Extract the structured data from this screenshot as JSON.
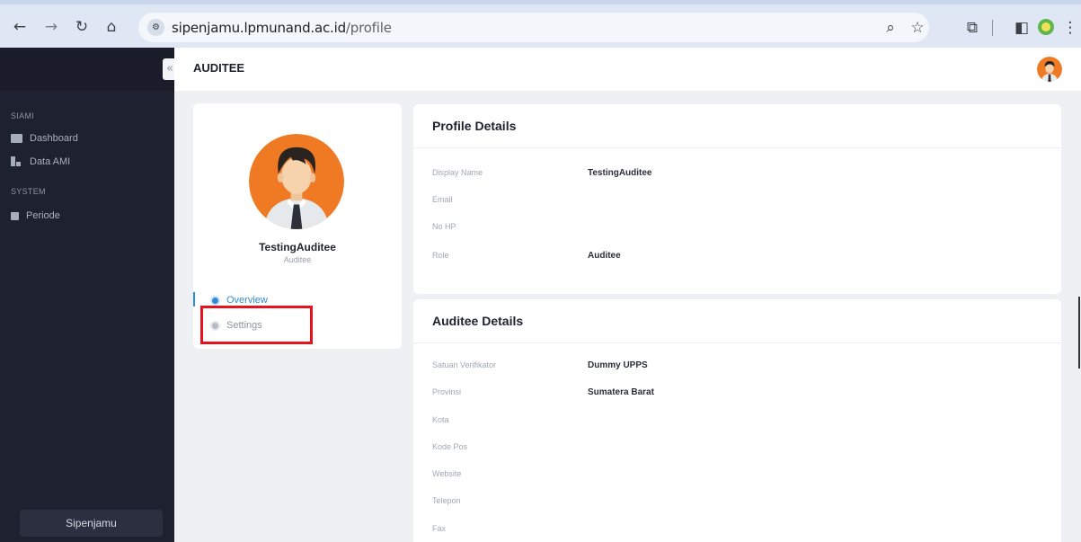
{
  "browser": {
    "url_host": "sipenjamu.lpmunand.ac.id",
    "url_path": "/profile",
    "icons": [
      "back-icon",
      "forward-icon",
      "reload-icon",
      "home-icon",
      "site-settings-icon",
      "zoom-icon",
      "bookmark-star-icon",
      "extensions-icon",
      "sidepanel-icon",
      "profile-icon",
      "menu-icon"
    ]
  },
  "sidebar": {
    "sections": [
      {
        "heading": "SIAMI",
        "items": [
          {
            "label": "Dashboard",
            "icon": "monitor-icon"
          },
          {
            "label": "Data AMI",
            "icon": "chart-icon"
          }
        ]
      },
      {
        "heading": "SYSTEM",
        "items": [
          {
            "label": "Periode",
            "icon": "calendar-icon"
          }
        ]
      }
    ],
    "footer": "Sipenjamu",
    "collapse_glyph": "«"
  },
  "appbar": {
    "title": "AUDITEE"
  },
  "profile": {
    "name": "TestingAuditee",
    "role": "Auditee",
    "menu": [
      {
        "label": "Overview",
        "active": true
      },
      {
        "label": "Settings",
        "active": false
      }
    ]
  },
  "profile_details": {
    "title": "Profile Details",
    "rows": [
      {
        "label": "Display Name",
        "value": "TestingAuditee"
      },
      {
        "label": "Email",
        "value": ""
      },
      {
        "label": "No HP",
        "value": ""
      },
      {
        "label": "Role",
        "value": "Auditee"
      }
    ]
  },
  "auditee_details": {
    "title": "Auditee Details",
    "rows": [
      {
        "label": "Satuan Verifikator",
        "value": "Dummy UPPS"
      },
      {
        "label": "Provinsi",
        "value": "Sumatera Barat"
      },
      {
        "label": "Kota",
        "value": ""
      },
      {
        "label": "Kode Pos",
        "value": ""
      },
      {
        "label": "Website",
        "value": ""
      },
      {
        "label": "Telepon",
        "value": ""
      },
      {
        "label": "Fax",
        "value": ""
      }
    ]
  },
  "colors": {
    "sidebar_bg": "#1e2130",
    "accent": "#2f8bd6",
    "highlight": "#e5131d",
    "avatar_bg": "#f07a24"
  }
}
